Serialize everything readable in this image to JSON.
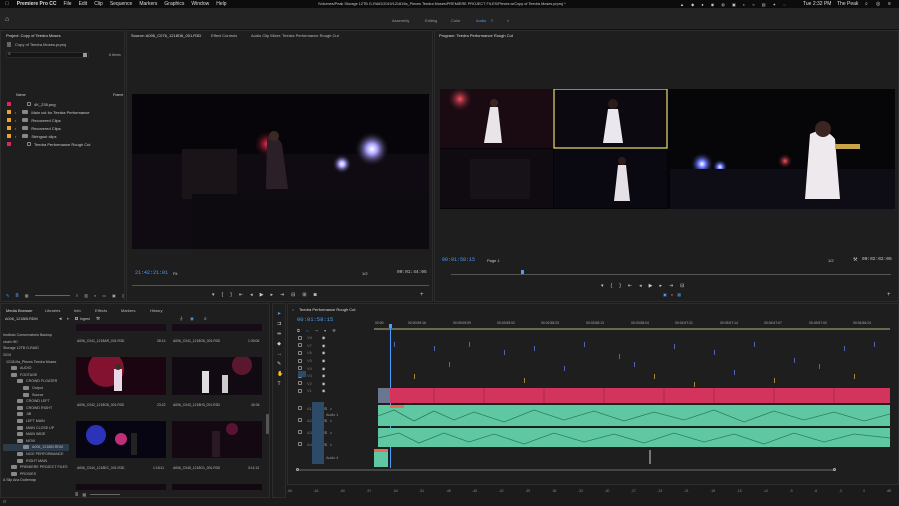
{
  "menubar": {
    "app": "Premiere Pro CC",
    "items": [
      "File",
      "Edit",
      "Clip",
      "Sequence",
      "Markers",
      "Graphics",
      "Window",
      "Help"
    ],
    "path": "/Volumes/Peak Storage 12TB G-RAID/2019/121819a_Pieces Teedra Moses/PREMIERE PROJECT FILES/Pieces w/Copy of Teedra Moses.prproj *",
    "time": "Tue 2:32 PM",
    "user": "The Peak"
  },
  "workspaces": {
    "items": [
      "Assembly",
      "Editing",
      "Color",
      "Audio"
    ],
    "active": "Audio",
    "more": "»"
  },
  "project": {
    "tab": "Project: Copy of Teedra Moses",
    "file": "Copy of Teedra Moses.prproj",
    "count": "6 Items",
    "col_name": "Name",
    "col_fps": "Frame",
    "items": [
      {
        "label": "4K_235.png",
        "color": "#d9a7c7"
      },
      {
        "label": "Main cut for Teedra Performance",
        "color": "#f0a030"
      },
      {
        "label": "Recovered Clips",
        "color": "#f0a030"
      },
      {
        "label": "Recovered Clips",
        "color": "#f0a030"
      },
      {
        "label": "Stringout clips",
        "color": "#f0a030"
      },
      {
        "label": "Teedra Performance Rough Cut",
        "color": "#e0245e"
      }
    ]
  },
  "source": {
    "tabs": [
      "Source: A006_C076_1218O6_001.R3D",
      "Effect Controls",
      "Audio Clip Mixer: Teedra Performance Rough Cut"
    ],
    "timecode": "21:42:21:01",
    "fit": "Fit",
    "ratio": "1/2",
    "duration": "00:01:44:05"
  },
  "program": {
    "tab": "Program: Teedra Performance Rough Cut",
    "timecode": "00:01:58:15",
    "page": "Page 1",
    "ratio": "1/2",
    "duration": "00:02:02:06"
  },
  "media": {
    "tabs": [
      "Media Browser",
      "Libraries",
      "Info",
      "Effects",
      "Markers",
      "History"
    ],
    "path_dropdown": "A006_1218IB.RDM",
    "ingest": "Ingest",
    "tree": [
      "Instituto Conservatorio Backup",
      "ctosh HD",
      "Storage 12TB G-RAID",
      "2019",
      "121819a_Pieces Teedra Moses",
      "AUDIO",
      "FOOTAGE",
      "CROWD FLOATER",
      "Output",
      "Source",
      "CROWD LEFT",
      "CROWD RIGHT",
      "JIB",
      "LEFT MAIN",
      "MAIN CLOSE UP",
      "MAIN WIDE",
      "MOVI",
      "A006_1218IB.RDM",
      "NICE PERFORMANCE",
      "RIGHT MAIN",
      "PREMIERE PROJECT FILES",
      "PROXIES",
      "A Slip Ana Dulternap"
    ],
    "thumbs": [
      {
        "name": "A006_C041_1218AR_001.R3D",
        "dur": "28:14"
      },
      {
        "name": "A006_C041_1218O6_001.R3D",
        "dur": "1:30:06"
      },
      {
        "name": "A006_C042_1218O8_001.R3D",
        "dur": "23:22"
      },
      {
        "name": "A006_C043_1218H3_001.R3D",
        "dur": "40:04"
      },
      {
        "name": "A006_C044_1218EC_001.R3D",
        "dur": "1:18:11"
      },
      {
        "name": "A006_C045_1218O1_001.R3D",
        "dur": "3:11:13"
      }
    ]
  },
  "timeline": {
    "tab": "Teedra Performance Rough Cut",
    "timecode": "00:01:58:15",
    "ruler": [
      "00:00",
      "00:00:59:16",
      "00:09:09:09",
      "00:03:59:02",
      "00:02:58:23",
      "00:03:58:13",
      "00:03:58:04",
      "00:04:57:21",
      "00:05:57:14",
      "00:04:57:07",
      "00:49:57:00",
      "00:04:56:24"
    ],
    "audio_labels": [
      "Audio 1",
      "Audio 4"
    ],
    "video_tracks": [
      "V8",
      "V7",
      "V6",
      "V5",
      "V4",
      "V3",
      "V2",
      "V1"
    ],
    "audio_tracks": [
      "A1",
      "A2",
      "A3",
      "A4"
    ]
  },
  "meter": {
    "labels": [
      "-66",
      "-63",
      "-60",
      "-57",
      "-54",
      "-51",
      "-48",
      "-45",
      "-42",
      "-39",
      "-36",
      "-33",
      "-30",
      "-27",
      "-24",
      "-21",
      "-18",
      "-15",
      "-12",
      "-9",
      "-6",
      "-3",
      "0",
      "dB"
    ]
  },
  "colors": {
    "accent": "#4a9eff",
    "video_clip": "#d2345e",
    "audio_clip": "#5fc8a2",
    "selection": "#f0e060"
  }
}
